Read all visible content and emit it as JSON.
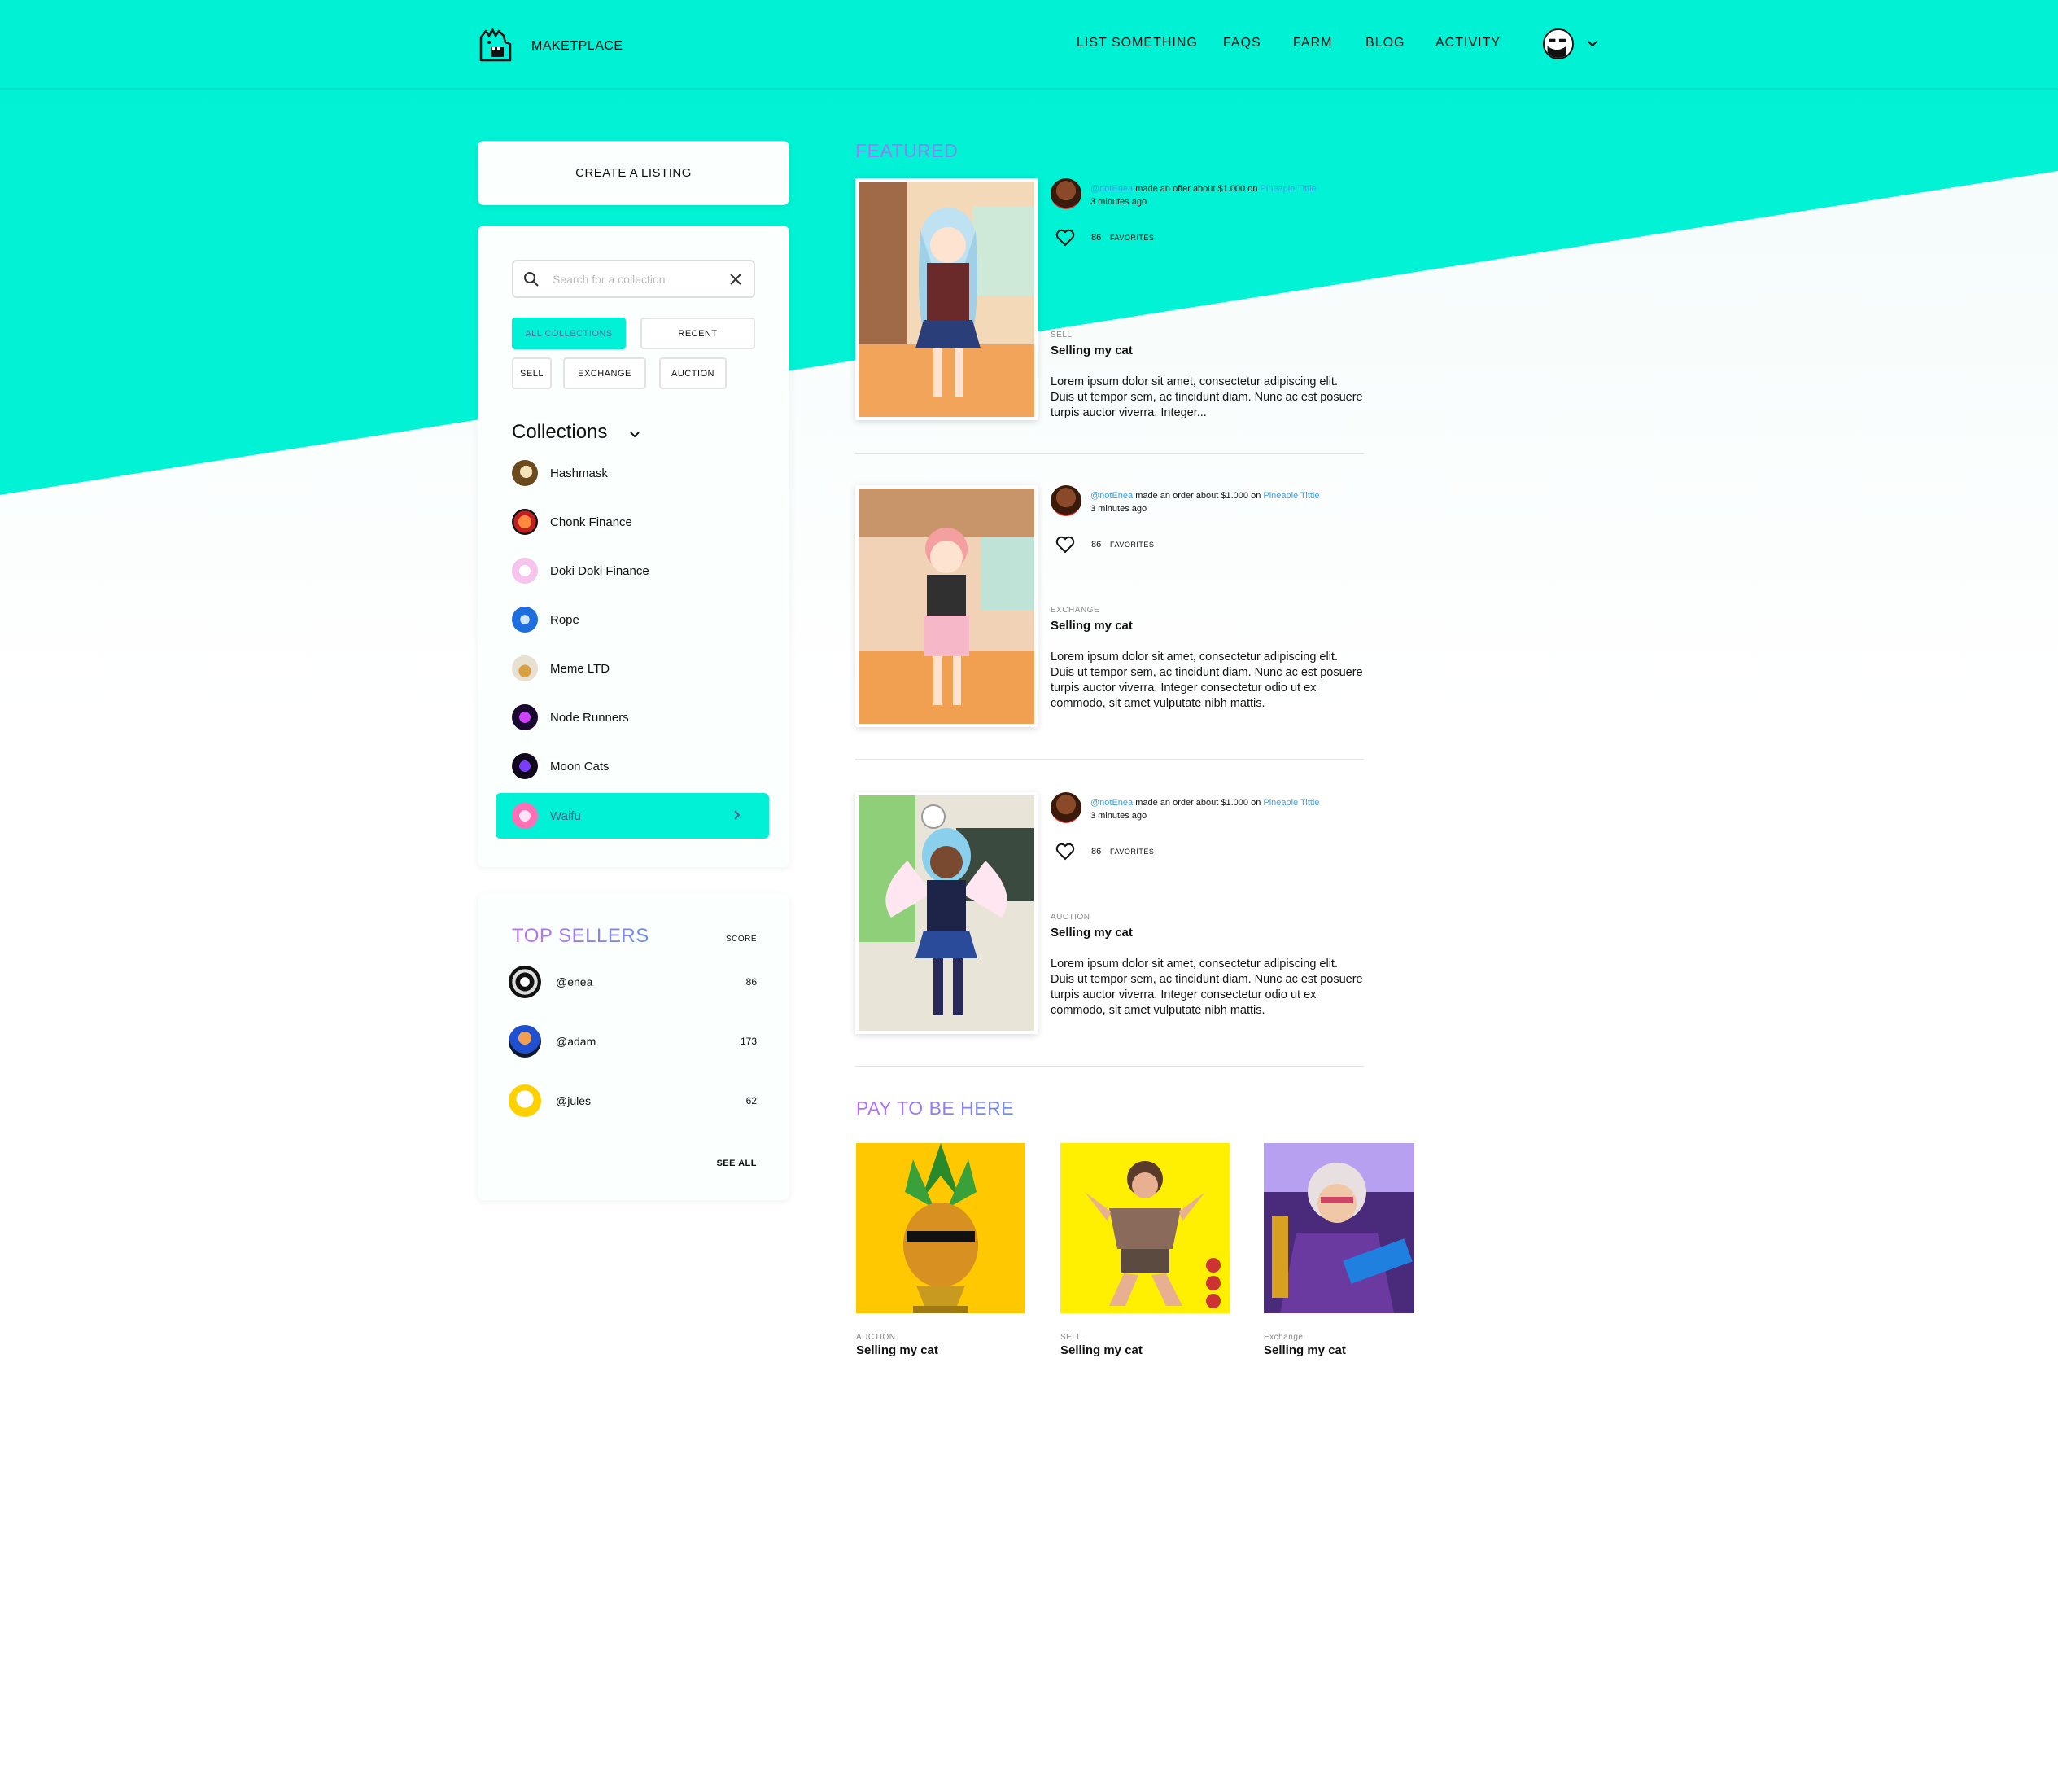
{
  "header": {
    "brand": "MAKETPLACE",
    "nav": [
      "LIST SOMETHING",
      "FAQS",
      "FARM",
      "BLOG",
      "ACTIVITY"
    ]
  },
  "sidebar": {
    "create_label": "CREATE A LISTING",
    "search_placeholder": "Search for a  collection",
    "filters": [
      "ALL COLLECTIONS",
      "RECENT",
      "SELL",
      "EXCHANGE",
      "AUCTION"
    ],
    "collections_title": "Collections",
    "collections": [
      {
        "label": "Hashmask",
        "icon": "hashmask-icon"
      },
      {
        "label": "Chonk Finance",
        "icon": "chonk-finance-icon"
      },
      {
        "label": "Doki Doki Finance",
        "icon": "doki-doki-icon"
      },
      {
        "label": "Rope",
        "icon": "rope-icon"
      },
      {
        "label": "Meme LTD",
        "icon": "meme-ltd-icon"
      },
      {
        "label": "Node Runners",
        "icon": "node-runners-icon"
      },
      {
        "label": "Moon Cats",
        "icon": "moon-cats-icon"
      }
    ],
    "selected_collection": "Waifu"
  },
  "top_sellers": {
    "title": "TOP SELLERS",
    "score_label": "SCORE",
    "sellers": [
      {
        "name": "@enea",
        "score": "86"
      },
      {
        "name": "@adam",
        "score": "173"
      },
      {
        "name": "@jules",
        "score": "62"
      }
    ],
    "see_all": "SEE ALL"
  },
  "featured": {
    "title": "FEATURED",
    "items": [
      {
        "user": "@notEnea",
        "action": " made an offer about $1.000 on ",
        "target": "Pineaple Tittle",
        "time": "3 minutes ago",
        "favorites_count": "86",
        "favorites_label": "FAVORITES",
        "type": "SELL",
        "title": "Selling my cat",
        "description": "Lorem ipsum dolor sit amet, consectetur adipiscing elit. Duis ut tempor sem, ac tincidunt diam. Nunc ac est posuere turpis auctor viverra. Integer..."
      },
      {
        "user": "@notEnea",
        "action": " made an order about $1.000 on ",
        "target": "Pineaple Tittle",
        "time": "3 minutes ago",
        "favorites_count": "86",
        "favorites_label": "FAVORITES",
        "type": "EXCHANGE",
        "title": "Selling my cat",
        "description": "Lorem ipsum dolor sit amet, consectetur adipiscing elit. Duis ut tempor sem, ac tincidunt diam. Nunc ac est posuere turpis auctor viverra. Integer consectetur odio ut ex commodo, sit amet vulputate nibh mattis."
      },
      {
        "user": "@notEnea",
        "action": " made an order about $1.000 on ",
        "target": "Pineaple Tittle",
        "time": "3 minutes ago",
        "favorites_count": "86",
        "favorites_label": "FAVORITES",
        "type": "AUCTION",
        "title": "Selling my cat",
        "description": "Lorem ipsum dolor sit amet, consectetur adipiscing elit. Duis ut tempor sem, ac tincidunt diam. Nunc ac est posuere turpis auctor viverra. Integer consectetur odio ut ex commodo, sit amet vulputate nibh mattis."
      }
    ]
  },
  "promoted": {
    "title": "PAY TO BE HERE",
    "items": [
      {
        "type": "AUCTION",
        "title": "Selling my cat"
      },
      {
        "type": "SELL",
        "title": "Selling my cat"
      },
      {
        "type": "Exchange",
        "title": "Selling my cat"
      }
    ]
  },
  "colors": {
    "accent": "#00f1d5",
    "heading_gradient_start": "#b96cff",
    "heading_gradient_end": "#6f8fe8",
    "link": "#3aa0e8"
  }
}
